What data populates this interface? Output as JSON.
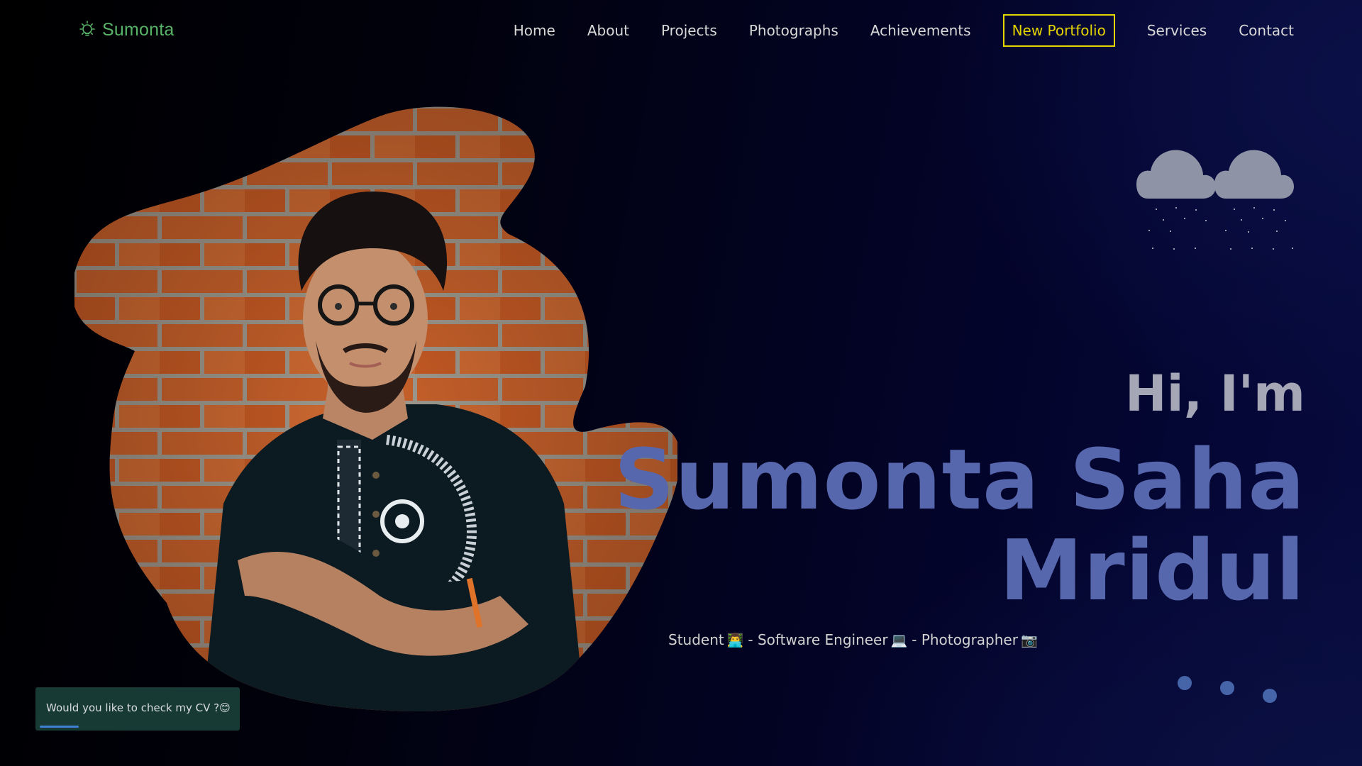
{
  "nav": {
    "logo_text": "Sumonta",
    "logo_icon": "lightbulb-icon",
    "items": [
      {
        "label": "Home"
      },
      {
        "label": "About"
      },
      {
        "label": "Projects"
      },
      {
        "label": "Photographs"
      },
      {
        "label": "Achievements"
      },
      {
        "label": "New Portfolio",
        "highlighted": true
      },
      {
        "label": "Services"
      },
      {
        "label": "Contact"
      }
    ]
  },
  "hero": {
    "greeting": "Hi, I'm",
    "name_line1": "Sumonta Saha",
    "name_line2": "Mridul",
    "tagline": {
      "role1": "Student",
      "role1_emoji": "👨‍💻",
      "role2": "- Software Engineer",
      "role2_emoji": "💻",
      "role3": "- Photographer",
      "role3_emoji": "📷",
      "sep": "- "
    }
  },
  "cv_toast": {
    "text": "Would you like to check my CV ?😊",
    "progress": 0.2
  },
  "colors": {
    "accent_name": "#5767ad",
    "greeting": "#a5a7b7",
    "highlight_outline": "#e4d400",
    "logo_green": "#58b368",
    "toast_bg": "#173a35"
  }
}
